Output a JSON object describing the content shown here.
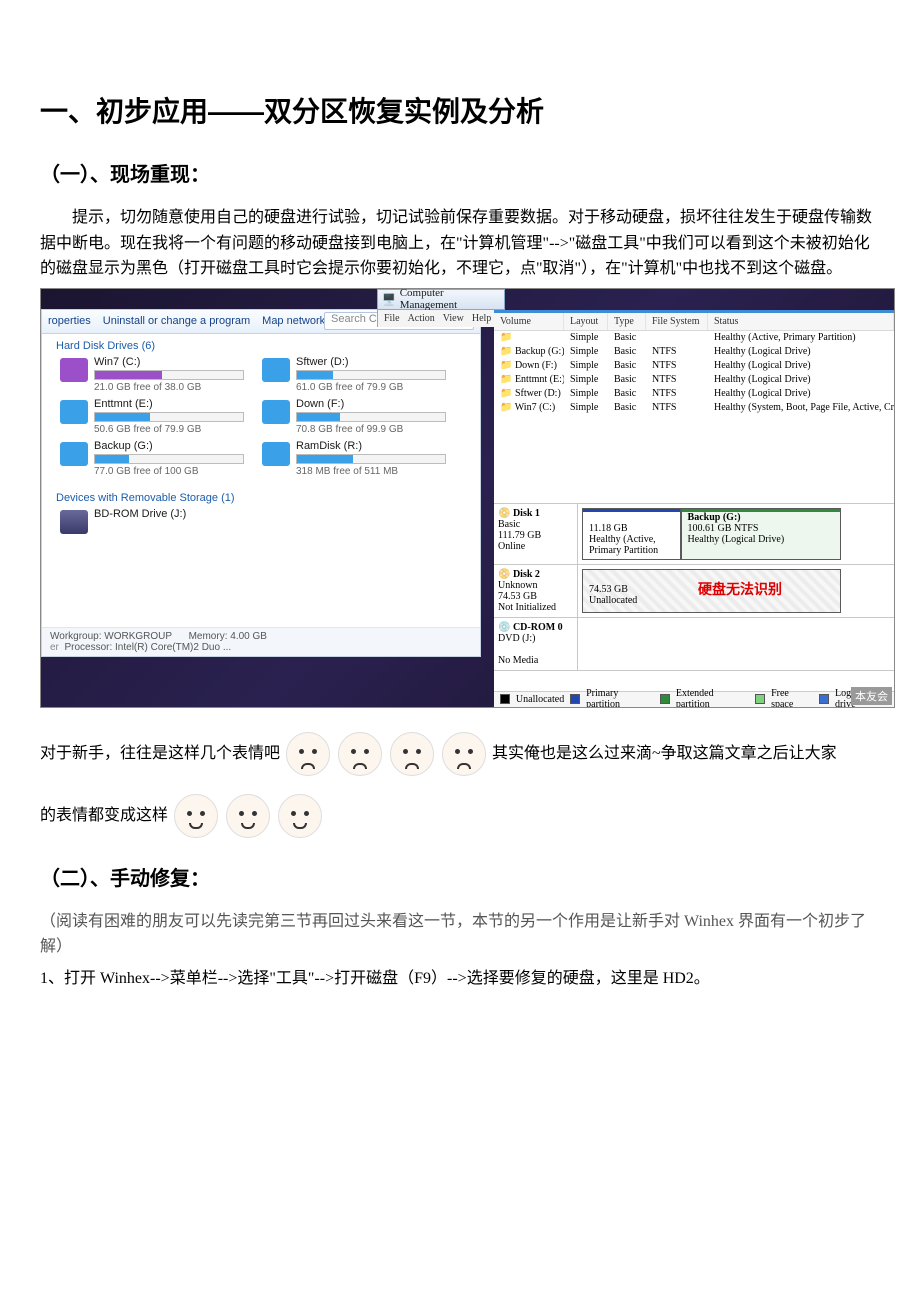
{
  "heading1": "一、初步应用——双分区恢复实例及分析",
  "section1_title": "（一）、现场重现：",
  "para1": "提示，切勿随意使用自己的硬盘进行试验，切记试验前保存重要数据。对于移动硬盘，损坏往往发生于硬盘传输数据中断电。现在我将一个有问题的移动硬盘接到电脑上，在\"计算机管理\"-->\"磁盘工具\"中我们可以看到这个未被初始化的磁盘显示为黑色（打开磁盘工具时它会提示你要初始化，不理它，点\"取消\"），在\"计算机\"中也找不到这个磁盘。",
  "explorer": {
    "toolbar": {
      "properties": "roperties",
      "uninstall": "Uninstall or change a program",
      "mapdrive": "Map network drive",
      "more": "»"
    },
    "search_placeholder": "Search Computer",
    "hd_header": "Hard Disk Drives (6)",
    "removable_header": "Devices with Removable Storage (1)",
    "drives": [
      {
        "name": "Win7 (C:)",
        "sub": "21.0 GB free of 38.0 GB",
        "fill": 45,
        "color": "#9b4fc9"
      },
      {
        "name": "Sftwer (D:)",
        "sub": "61.0 GB free of 79.9 GB",
        "fill": 24,
        "color": "#3aa0e8"
      },
      {
        "name": "Enttmnt (E:)",
        "sub": "50.6 GB free of 79.9 GB",
        "fill": 37,
        "color": "#3aa0e8"
      },
      {
        "name": "Down (F:)",
        "sub": "70.8 GB free of 99.9 GB",
        "fill": 29,
        "color": "#3aa0e8"
      },
      {
        "name": "Backup (G:)",
        "sub": "77.0 GB free of 100 GB",
        "fill": 23,
        "color": "#3aa0e8"
      },
      {
        "name": "RamDisk (R:)",
        "sub": "318 MB free of 511 MB",
        "fill": 38,
        "color": "#3aa0e8"
      }
    ],
    "bd": "BD-ROM Drive (J:)",
    "sys": {
      "wg_label": "Workgroup:",
      "wg": "WORKGROUP",
      "mem_label": "Memory:",
      "mem": "4.00 GB",
      "cpu_label": "Processor:",
      "cpu": "Intel(R) Core(TM)2 Duo ..."
    }
  },
  "mgmt": {
    "title": "Computer Management",
    "menu": [
      "File",
      "Action",
      "View",
      "Help"
    ],
    "vol_header": [
      "Volume",
      "Layout",
      "Type",
      "File System",
      "Status"
    ],
    "volumes": [
      {
        "v": "",
        "l": "Simple",
        "t": "Basic",
        "fs": "",
        "s": "Healthy (Active, Primary Partition)"
      },
      {
        "v": "Backup (G:)",
        "l": "Simple",
        "t": "Basic",
        "fs": "NTFS",
        "s": "Healthy (Logical Drive)"
      },
      {
        "v": "Down (F:)",
        "l": "Simple",
        "t": "Basic",
        "fs": "NTFS",
        "s": "Healthy (Logical Drive)"
      },
      {
        "v": "Enttmnt (E:)",
        "l": "Simple",
        "t": "Basic",
        "fs": "NTFS",
        "s": "Healthy (Logical Drive)"
      },
      {
        "v": "Sftwer (D:)",
        "l": "Simple",
        "t": "Basic",
        "fs": "NTFS",
        "s": "Healthy (Logical Drive)"
      },
      {
        "v": "Win7 (C:)",
        "l": "Simple",
        "t": "Basic",
        "fs": "NTFS",
        "s": "Healthy (System, Boot, Page File, Active, Crash Dump, Primary Pa"
      }
    ],
    "disk1": {
      "name": "Disk 1",
      "type": "Basic",
      "size": "111.79 GB",
      "state": "Online",
      "p1": {
        "size": "11.18 GB",
        "status": "Healthy (Active, Primary Partition"
      },
      "p2": {
        "title": "Backup (G:)",
        "size": "100.61 GB NTFS",
        "status": "Healthy (Logical Drive)"
      }
    },
    "disk2": {
      "name": "Disk 2",
      "type": "Unknown",
      "size": "74.53 GB",
      "state": "Not Initialized",
      "p1": {
        "size": "74.53 GB",
        "status": "Unallocated"
      },
      "overlay": "硬盘无法识别"
    },
    "cdrom": {
      "name": "CD-ROM 0",
      "dev": "DVD (J:)",
      "state": "No Media"
    },
    "legend": [
      "Unallocated",
      "Primary partition",
      "Extended partition",
      "Free space",
      "Logical drive"
    ],
    "legend_colors": [
      "#000000",
      "#2446b0",
      "#2f8a3b",
      "#7fd07f",
      "#3a6fd0"
    ]
  },
  "watermark": "本友会",
  "para2a": "对于新手，往往是这样几个表情吧",
  "para2b": "其实俺也是这么过来滴~争取这篇文章之后让大家",
  "para2c": "的表情都变成这样",
  "section2_title": "（二）、手动修复：",
  "para3": "（阅读有困难的朋友可以先读完第三节再回过头来看这一节，本节的另一个作用是让新手对 Winhex 界面有一个初步了解）",
  "para4": "1、打开 Winhex-->菜单栏-->选择\"工具\"-->打开磁盘（F9）-->选择要修复的硬盘，这里是 HD2。"
}
